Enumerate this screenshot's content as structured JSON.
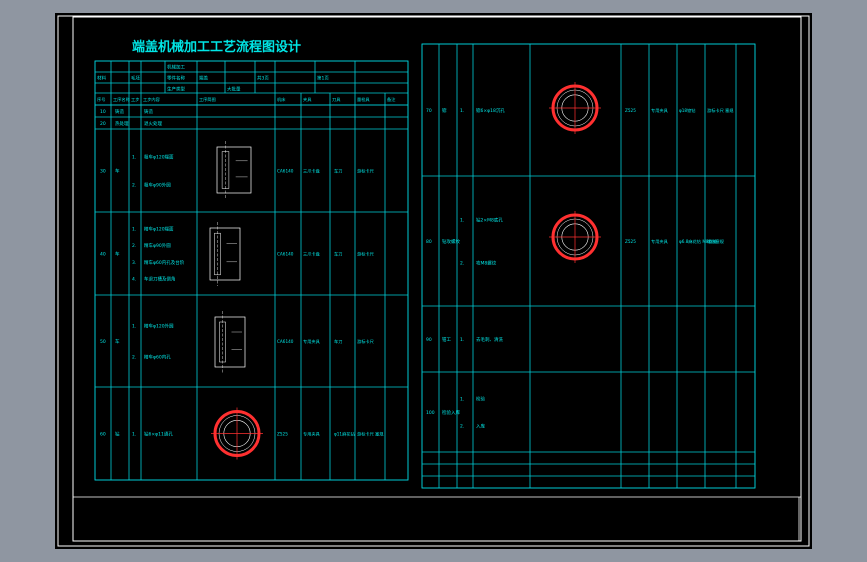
{
  "title": "端盖机械加工工艺流程图设计",
  "colors": {
    "background": "#000000",
    "frame": "#ffffff",
    "table_lines": "#00cfd8",
    "text": "#00e5e5",
    "red_hatch": "#ff3030",
    "outer_background": "#8f96a1"
  },
  "left_table": {
    "header": {
      "row1": [
        "",
        "",
        "",
        "",
        "机械加工",
        "",
        "",
        "",
        "",
        "",
        ""
      ],
      "row2": [
        "材料",
        "",
        "毛坯",
        "",
        "零件名称",
        "端盖",
        "",
        "共3页",
        "",
        "第1页"
      ],
      "row3": [
        "",
        "",
        "",
        "",
        "生产类型",
        "",
        "大批量",
        "",
        "",
        "",
        ""
      ],
      "columns": [
        "序号",
        "工序名称",
        "工步",
        "工步内容",
        "工序简图",
        "机床",
        "夹具",
        "刀具",
        "量检具",
        "备注"
      ]
    },
    "rows": [
      {
        "no": "10",
        "name": "铸造",
        "steps": [],
        "content": [
          "铸造"
        ],
        "machine": "",
        "fixture": "",
        "tool": "",
        "gauge": ""
      },
      {
        "no": "20",
        "name": "热处理",
        "steps": [],
        "content": [
          "退火处理"
        ],
        "machine": "",
        "fixture": "",
        "tool": "",
        "gauge": ""
      },
      {
        "no": "30",
        "name": "车",
        "steps": [
          "1.",
          "2."
        ],
        "content": [
          "粗车φ120端面",
          "粗车φ90外圆"
        ],
        "machine": "CA6140",
        "fixture": "三爪卡盘",
        "tool": "车刀",
        "gauge": "游标卡尺"
      },
      {
        "no": "40",
        "name": "车",
        "steps": [
          "1.",
          "2.",
          "3.",
          "4."
        ],
        "content": [
          "精车φ120端面",
          "精车φ90外圆",
          "精车φ60内孔及台阶",
          "车退刀槽及倒角"
        ],
        "machine": "CA6140",
        "fixture": "三爪卡盘",
        "tool": "车刀",
        "gauge": "游标卡尺"
      },
      {
        "no": "50",
        "name": "车",
        "steps": [
          "1.",
          "2."
        ],
        "content": [
          "精车φ120外圆",
          "精车φ60内孔"
        ],
        "machine": "CA6140",
        "fixture": "专用夹具",
        "tool": "车刀",
        "gauge": "游标卡尺"
      },
      {
        "no": "60",
        "name": "钻",
        "steps": [
          "1."
        ],
        "content": [
          "钻6×φ11通孔"
        ],
        "machine": "Z525",
        "fixture": "专用夹具",
        "tool": "φ11麻花钻",
        "gauge": "游标卡尺 塞规"
      }
    ]
  },
  "right_table": {
    "rows": [
      {
        "no": "70",
        "name": "锪",
        "steps": [
          "1."
        ],
        "content": [
          "锪6×φ18沉孔"
        ],
        "machine": "Z525",
        "fixture": "专用夹具",
        "tool": "φ18锪钻",
        "gauge": "游标卡尺 塞规"
      },
      {
        "no": "80",
        "name": "钻攻螺纹",
        "steps": [
          "1.",
          "2."
        ],
        "content": [
          "钻2×M8底孔",
          "攻M8螺纹"
        ],
        "machine": "Z525",
        "fixture": "专用夹具",
        "tool": "φ6.8麻花钻 M8丝锥",
        "gauge": "螺纹塞规"
      },
      {
        "no": "90",
        "name": "钳工",
        "steps": [
          "1."
        ],
        "content": [
          "去毛刺、清洗"
        ],
        "machine": "",
        "fixture": "",
        "tool": "",
        "gauge": ""
      },
      {
        "no": "100",
        "name": "检验入库",
        "steps": [
          "1.",
          "2."
        ],
        "content": [
          "检验",
          "入库"
        ],
        "machine": "",
        "fixture": "",
        "tool": "",
        "gauge": ""
      }
    ]
  }
}
